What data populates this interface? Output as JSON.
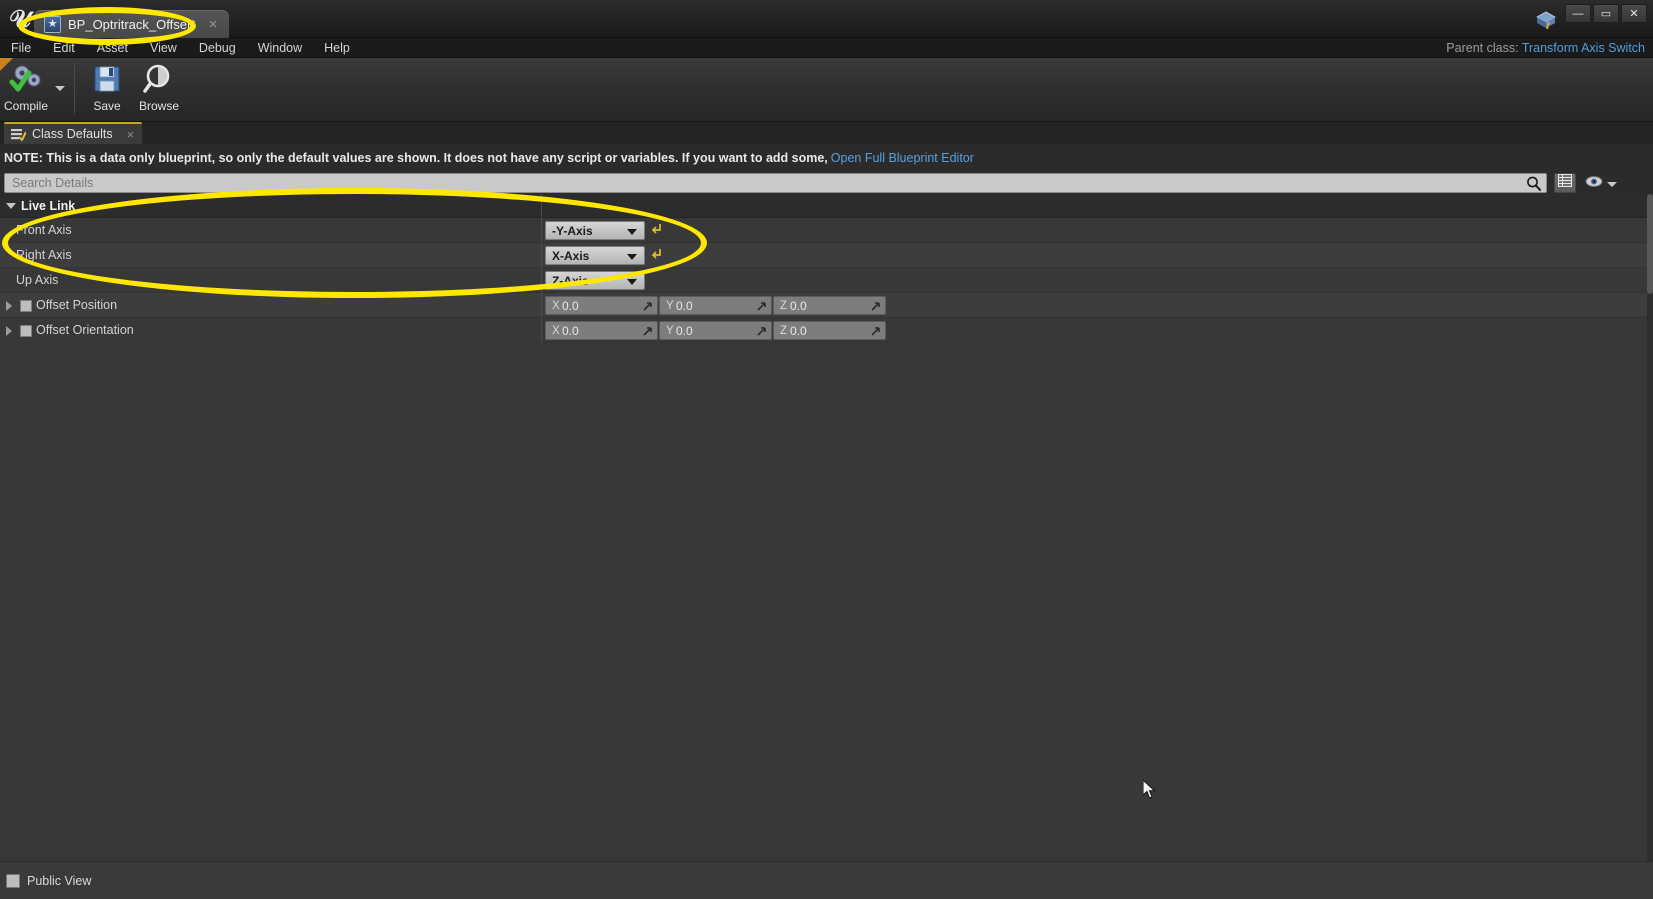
{
  "window": {
    "tab_title": "BP_Optritrack_Offset*",
    "tab_icon": "blueprint-icon",
    "close_glyph": "×",
    "minimize_glyph": "—",
    "maximize_glyph": "▭",
    "close_btn_glyph": "✕"
  },
  "menubar": {
    "items": [
      {
        "label": "File"
      },
      {
        "label": "Edit"
      },
      {
        "label": "Asset"
      },
      {
        "label": "View"
      },
      {
        "label": "Debug"
      },
      {
        "label": "Window"
      },
      {
        "label": "Help"
      }
    ],
    "parent_class_label": "Parent class:",
    "parent_class_value": "Transform Axis Switch"
  },
  "toolbar": {
    "compile_label": "Compile",
    "save_label": "Save",
    "browse_label": "Browse"
  },
  "panel_tab": {
    "label": "Class Defaults",
    "close_glyph": "×"
  },
  "note": {
    "text": "NOTE: This is a data only blueprint, so only the default values are shown.  It does not have any script or variables.  If you want to add some,",
    "link": "Open Full Blueprint Editor"
  },
  "search": {
    "placeholder": "Search Details",
    "value": "",
    "icon": "magnifier-icon",
    "view_options_icon": "grid-view-icon",
    "visibility_icon": "eye-icon"
  },
  "details": {
    "category": "Live Link",
    "rows": [
      {
        "label": "Front Axis",
        "type": "combo",
        "value": "-Y-Axis",
        "has_reset": true
      },
      {
        "label": "Right Axis",
        "type": "combo",
        "value": "X-Axis",
        "has_reset": true
      },
      {
        "label": "Up Axis",
        "type": "combo",
        "value": "Z-Axis",
        "has_reset": false
      },
      {
        "label": "Offset Position",
        "type": "vector",
        "x_axis": "X",
        "x_value": "0.0",
        "y_axis": "Y",
        "y_value": "0.0",
        "z_axis": "Z",
        "z_value": "0.0"
      },
      {
        "label": "Offset Orientation",
        "type": "vector",
        "x_axis": "X",
        "x_value": "0.0",
        "y_axis": "Y",
        "y_value": "0.0",
        "z_axis": "Z",
        "z_value": "0.0"
      }
    ]
  },
  "bottom": {
    "public_view_label": "Public View"
  },
  "colors": {
    "highlight": "#ffe800",
    "link": "#5a9fe0",
    "accent_tab": "#c8a41e",
    "panel_bg": "#383838"
  }
}
